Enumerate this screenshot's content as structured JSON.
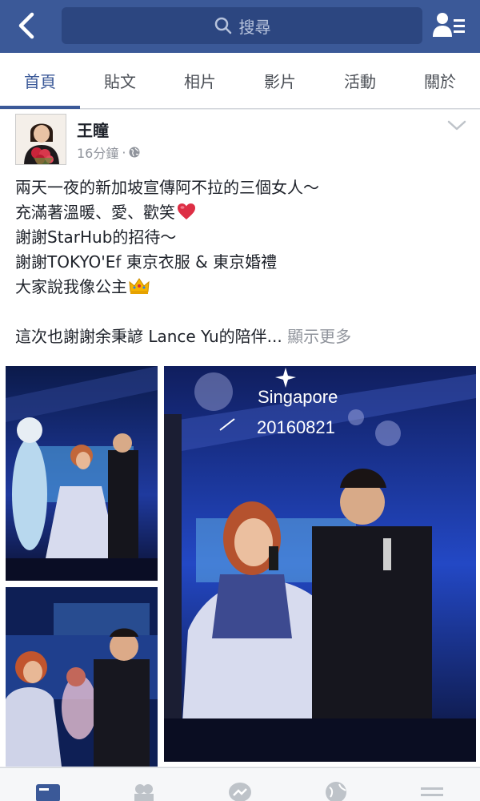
{
  "search": {
    "placeholder": "搜尋"
  },
  "tabs": [
    {
      "label": "首頁",
      "active": true
    },
    {
      "label": "貼文"
    },
    {
      "label": "相片"
    },
    {
      "label": "影片"
    },
    {
      "label": "活動"
    },
    {
      "label": "關於"
    }
  ],
  "post": {
    "author": "王瞳",
    "time": "16分鐘",
    "privacy_separator": "·",
    "lines": [
      "兩天一夜的新加坡宣傳阿不拉的三個女人～",
      "充滿著溫暖、愛、歡笑",
      "謝謝StarHub的招待～",
      "謝謝TOKYO'Ef 東京衣服 & 東京婚禮",
      "大家說我像公主",
      "這次也謝謝余秉諺 Lance Yu的陪伴..."
    ],
    "see_more": "顯示更多",
    "photo_overlay": {
      "line1": "Singapore",
      "line2": "20160821"
    }
  },
  "colors": {
    "brand": "#3b5998",
    "text": "#1d2129",
    "muted": "#90949c"
  }
}
